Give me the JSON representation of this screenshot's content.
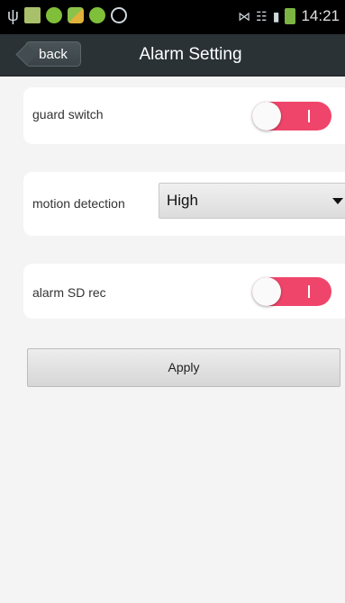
{
  "status_bar": {
    "left_icons": [
      "usb-icon",
      "sheet-icon",
      "green-app-icon",
      "app-icon",
      "green-app-icon",
      "ring-icon"
    ],
    "right_icons": [
      "signal-icon",
      "wifi-icon",
      "cell-signal-icon",
      "battery-icon"
    ],
    "time": "14:21"
  },
  "title_bar": {
    "back_label": "back",
    "title": "Alarm Setting"
  },
  "settings": {
    "guard_switch": {
      "label": "guard switch",
      "on": true
    },
    "motion_detection": {
      "label": "motion detection",
      "selected": "High"
    },
    "alarm_sd_rec": {
      "label": "alarm SD rec",
      "on": true
    }
  },
  "actions": {
    "apply_label": "Apply"
  },
  "colors": {
    "toggle_on": "#f0456b",
    "title_bar": "#2a3236",
    "background": "#f4f4f4"
  }
}
